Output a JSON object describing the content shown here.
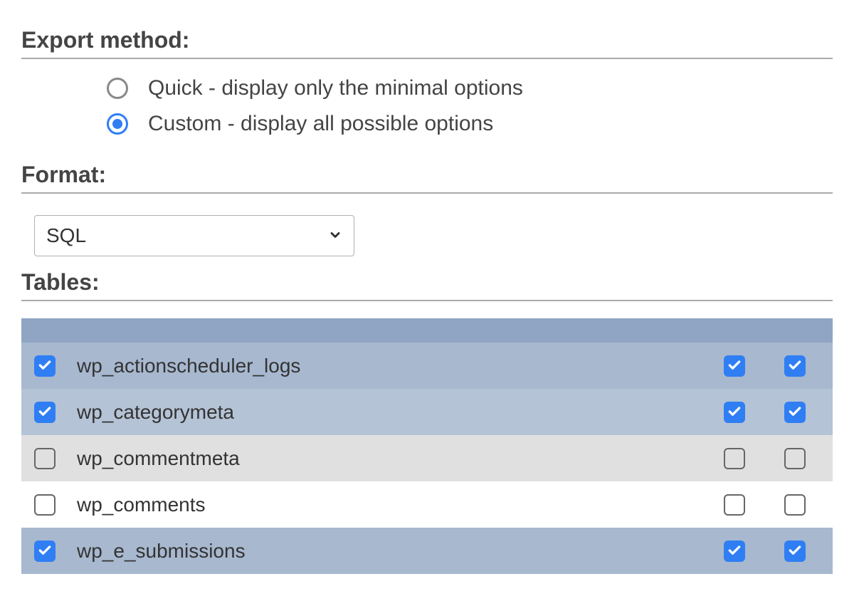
{
  "export_method": {
    "heading": "Export method:",
    "options": [
      {
        "label": "Quick - display only the minimal options",
        "selected": false
      },
      {
        "label": "Custom - display all possible options",
        "selected": true
      }
    ]
  },
  "format": {
    "heading": "Format:",
    "selected": "SQL"
  },
  "tables": {
    "heading": "Tables:",
    "rows": [
      {
        "name": "wp_actionscheduler_logs",
        "c1": true,
        "c2": true,
        "c3": true,
        "shade": 0
      },
      {
        "name": "wp_categorymeta",
        "c1": true,
        "c2": true,
        "c3": true,
        "shade": 1
      },
      {
        "name": "wp_commentmeta",
        "c1": false,
        "c2": false,
        "c3": false,
        "shade": 0
      },
      {
        "name": "wp_comments",
        "c1": false,
        "c2": false,
        "c3": false,
        "shade": 1
      },
      {
        "name": "wp_e_submissions",
        "c1": true,
        "c2": true,
        "c3": true,
        "shade": 0
      }
    ]
  }
}
